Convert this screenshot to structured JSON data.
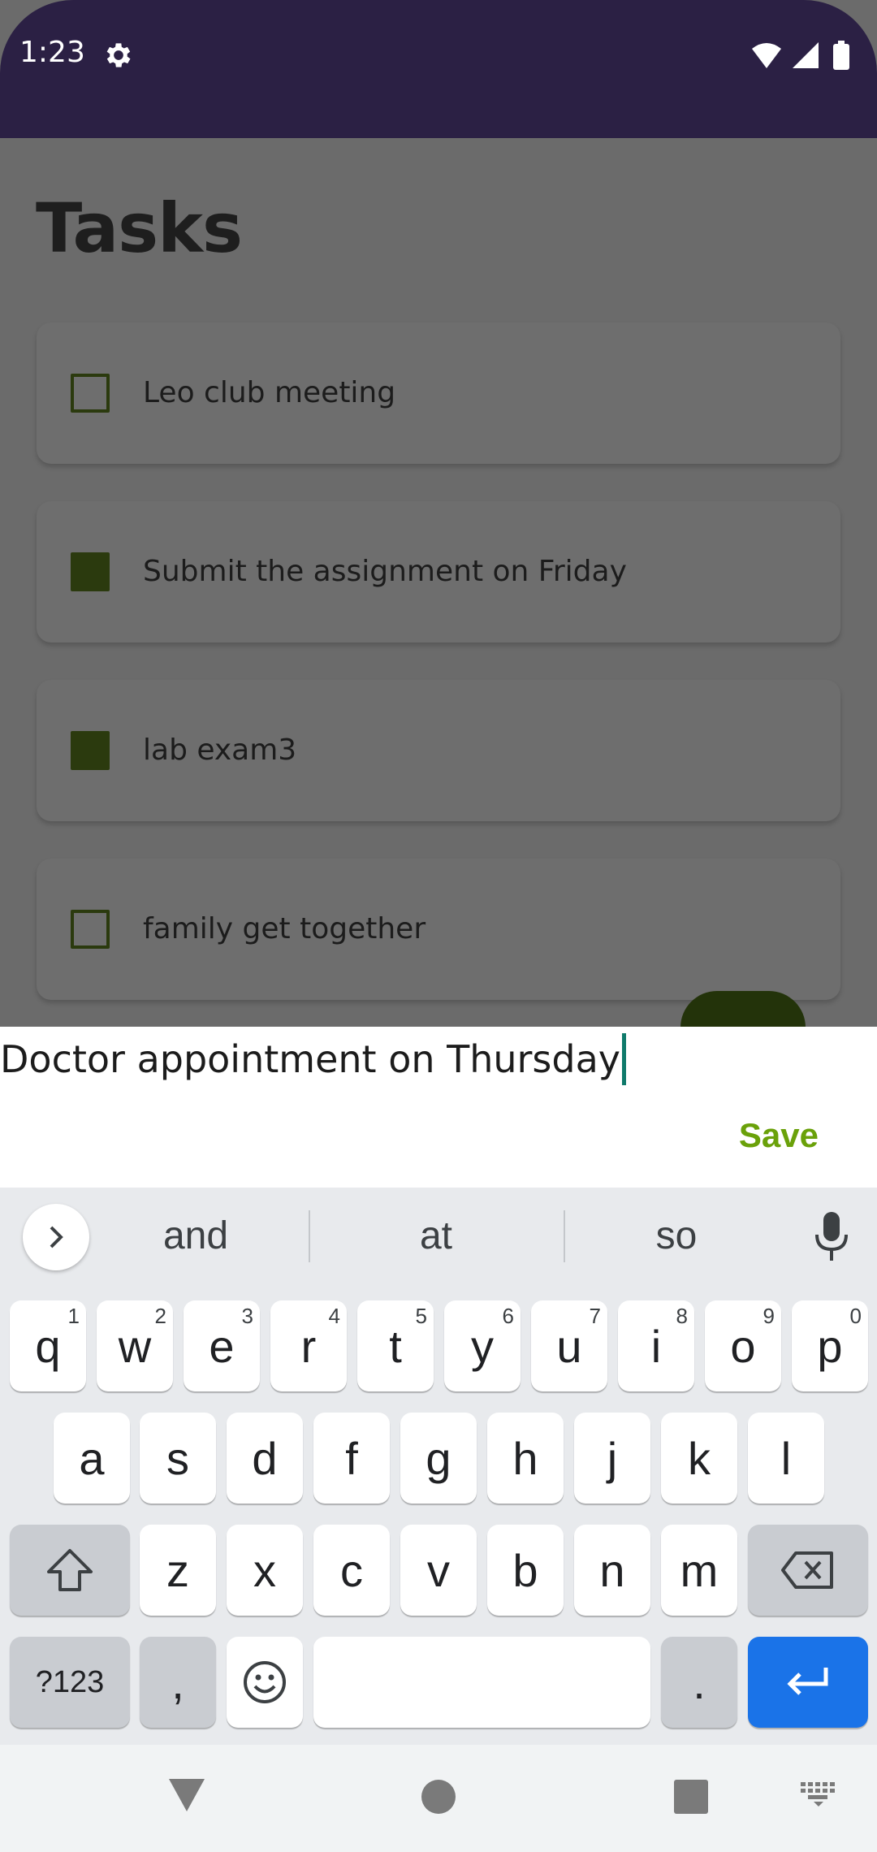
{
  "status_bar": {
    "time": "1:23",
    "icons": [
      "settings-gear-icon",
      "wifi-icon",
      "cellular-signal-icon",
      "battery-icon"
    ]
  },
  "screen": {
    "title": "Tasks"
  },
  "tasks": [
    {
      "label": "Leo club meeting",
      "checked": false
    },
    {
      "label": "Submit the assignment on Friday",
      "checked": true
    },
    {
      "label": "lab exam3",
      "checked": true
    },
    {
      "label": "family get together",
      "checked": false
    }
  ],
  "dialog": {
    "input_value": "Doctor appointment on Thursday",
    "save_label": "Save"
  },
  "keyboard": {
    "suggestions": [
      "and",
      "at",
      "so"
    ],
    "row1": [
      {
        "key": "q",
        "hint": "1"
      },
      {
        "key": "w",
        "hint": "2"
      },
      {
        "key": "e",
        "hint": "3"
      },
      {
        "key": "r",
        "hint": "4"
      },
      {
        "key": "t",
        "hint": "5"
      },
      {
        "key": "y",
        "hint": "6"
      },
      {
        "key": "u",
        "hint": "7"
      },
      {
        "key": "i",
        "hint": "8"
      },
      {
        "key": "o",
        "hint": "9"
      },
      {
        "key": "p",
        "hint": "0"
      }
    ],
    "row2": [
      "a",
      "s",
      "d",
      "f",
      "g",
      "h",
      "j",
      "k",
      "l"
    ],
    "row3": [
      "z",
      "x",
      "c",
      "v",
      "b",
      "n",
      "m"
    ],
    "symbols_label": "?123",
    "comma_label": ",",
    "period_label": "."
  },
  "colors": {
    "status_bar": "#2b2044",
    "checkbox": "#2b3a0e",
    "save": "#6aa10a",
    "enter_key": "#1a73e8",
    "caret": "#0f7a6b"
  }
}
